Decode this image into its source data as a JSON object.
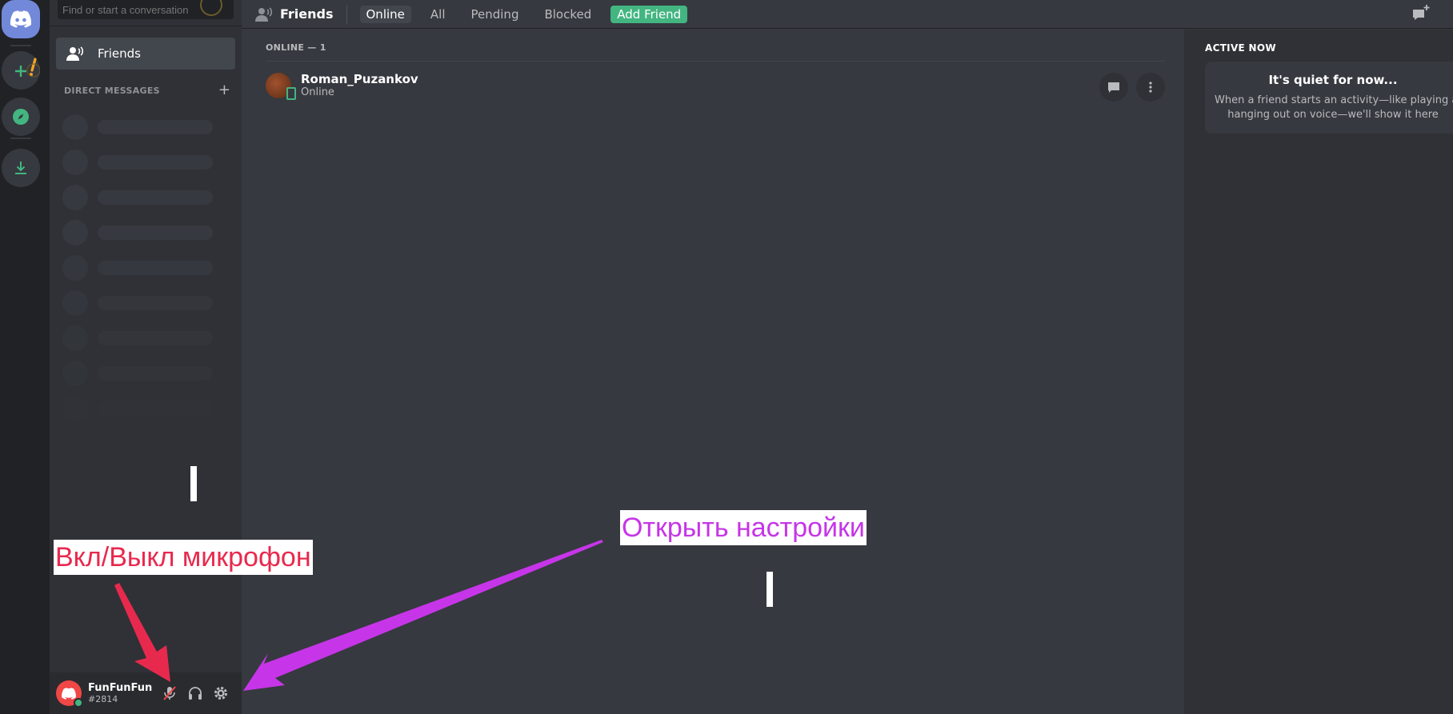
{
  "search": {
    "placeholder": "Find or start a conversation"
  },
  "sidebar": {
    "friends_label": "Friends",
    "dm_header": "DIRECT MESSAGES",
    "dm_add": "+"
  },
  "user": {
    "name": "FunFunFun",
    "tag": "#2814",
    "status_color": "#43b581"
  },
  "topbar": {
    "title": "Friends",
    "tabs": [
      {
        "label": "Online",
        "active": true
      },
      {
        "label": "All",
        "active": false
      },
      {
        "label": "Pending",
        "active": false
      },
      {
        "label": "Blocked",
        "active": false
      }
    ],
    "add_friend": "Add Friend"
  },
  "friends_list": {
    "header": "ONLINE — 1",
    "items": [
      {
        "name": "Roman_Puzankov",
        "status": "Online"
      }
    ]
  },
  "active_now": {
    "title": "ACTIVE NOW",
    "empty_heading": "It's quiet for now...",
    "empty_line1": "When a friend starts an activity—like playing a g",
    "empty_line2": "hanging out on voice—we'll show it here"
  },
  "annotations": {
    "mic": "Вкл/Выкл микрофон",
    "settings": "Открыть настройки"
  },
  "colors": {
    "accent": "#7289da",
    "green": "#43b581",
    "mic_annotation": "#e8294e",
    "settings_annotation": "#c635e8"
  }
}
